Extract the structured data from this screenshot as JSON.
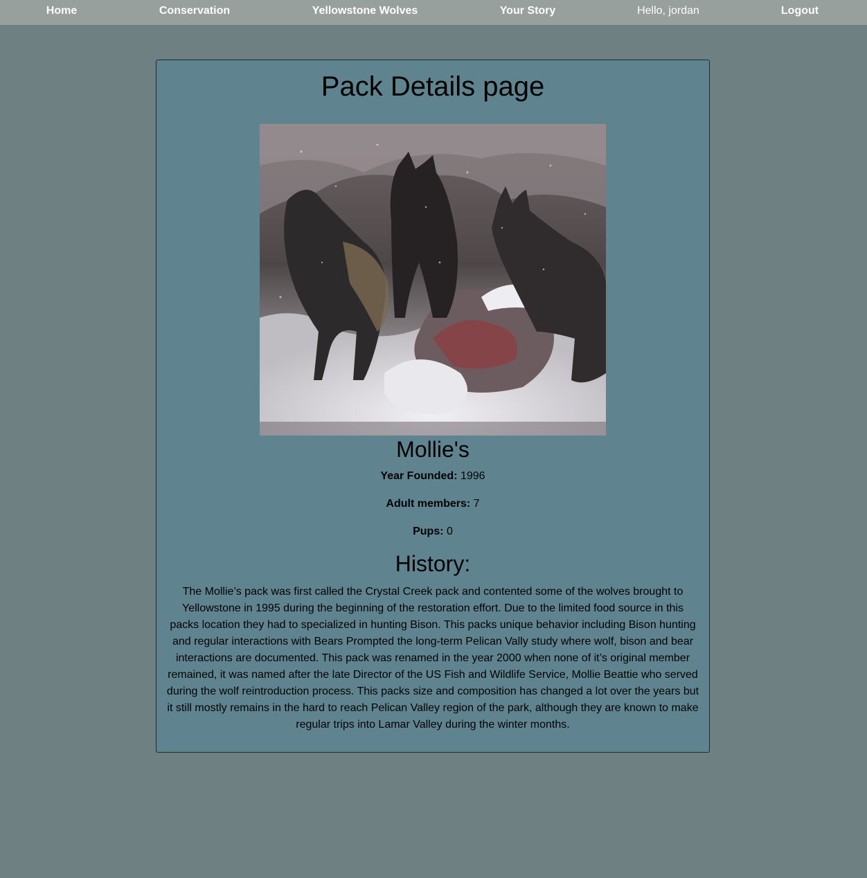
{
  "nav": {
    "home": "Home",
    "conservation": "Conservation",
    "wolves": "Yellowstone Wolves",
    "story": "Your Story",
    "greeting": "Hello, jordan",
    "logout": "Logout"
  },
  "page": {
    "title": "Pack Details page"
  },
  "pack": {
    "name": "Mollie's",
    "image_alt": "Wolves of the Mollie's pack in the snow",
    "year_label": "Year Founded:",
    "year_value": "1996",
    "adults_label": "Adult members:",
    "adults_value": "7",
    "pups_label": "Pups:",
    "pups_value": "0",
    "history_title": "History:",
    "history_text": "The Mollie’s pack was first called the Crystal Creek pack and contented some of the wolves brought to Yellowstone in 1995 during the beginning of the restoration effort. Due to the limited food source in this packs location they had to specialized in hunting Bison. This packs unique behavior including Bison hunting and regular interactions with Bears Prompted the long-term Pelican Vally study where wolf, bison and bear interactions are documented. This pack was renamed in the year 2000 when none of it’s original member remained, it was named after the late Director of the US Fish and Wildlife Service, Mollie Beattie who served during the wolf reintroduction process. This packs size and composition has changed a lot over the years but it still mostly remains in the hard to reach Pelican Valley region of the park, although they are known to make regular trips into Lamar Valley during the winter months."
  },
  "colors": {
    "page_bg": "#6f8082",
    "navbar_bg": "#98a09d",
    "card_bg": "#5f8490"
  }
}
